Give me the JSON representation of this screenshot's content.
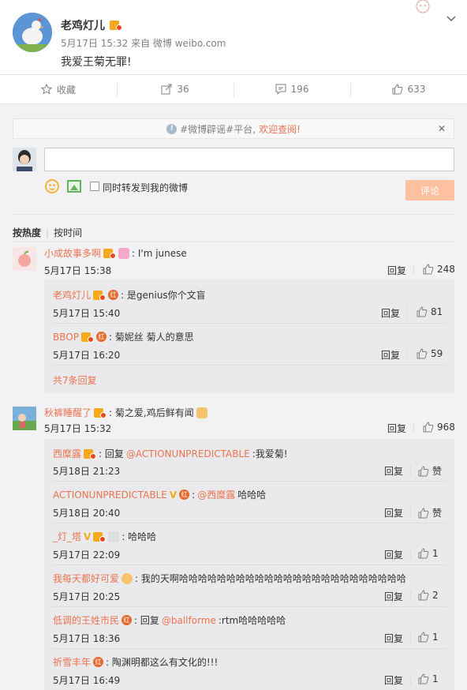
{
  "post": {
    "username": "老鸡灯儿",
    "meta": "5月17日 15:32 来自 微博 weibo.com",
    "text": "我爱王菊无罪!"
  },
  "actions": {
    "favorite": "收藏",
    "repost": "36",
    "comment": "196",
    "like": "633"
  },
  "notice": {
    "prefix": "#微博辟谣#平台,",
    "link": "欢迎查阅!"
  },
  "composer": {
    "forward_label": "同时转发到我的微博",
    "submit": "评论"
  },
  "sort": {
    "hot": "按热度",
    "time": "按时间"
  },
  "comments": [
    {
      "nick": "小成故事多啊",
      "text": ": I'm junese",
      "time": "5月17日 15:38",
      "reply": "回复",
      "likes": "248",
      "replies": [
        {
          "nick": "老鸡灯儿",
          "text": ": 是genius你个文盲",
          "time": "5月17日 15:40",
          "reply": "回复",
          "likes": "81"
        },
        {
          "nick": "BBOP",
          "text": ": 菊妮丝 菊人的意思",
          "time": "5月17日 16:20",
          "reply": "回复",
          "likes": "59"
        }
      ],
      "more": "共7条回复"
    },
    {
      "nick": "秋裤睡醒了",
      "text": ": 菊之爱,鸡后鲜有闻",
      "time": "5月17日 15:32",
      "reply": "回复",
      "likes": "968",
      "replies": [
        {
          "nick": "西糜露",
          "pre": ": 回复",
          "at": "@ACTIONUNPREDICTABLE",
          "text": ":我爱菊!",
          "time": "5月18日 21:23",
          "reply": "回复",
          "likes": "赞"
        },
        {
          "nick": "ACTIONUNPREDICTABLE",
          "pre": ":",
          "at": "@西糜露",
          "text": " 哈哈哈",
          "time": "5月18日 20:40",
          "reply": "回复",
          "likes": "赞"
        },
        {
          "nick": "_灯_塔",
          "text": ": 哈哈哈",
          "time": "5月17日 22:09",
          "reply": "回复",
          "likes": "1"
        },
        {
          "nick": "我每天都好可爱",
          "text": ": 我的天啊哈哈哈哈哈哈哈哈哈哈哈哈哈哈哈哈哈哈哈哈哈哈哈哈",
          "time": "5月17日 20:25",
          "reply": "回复",
          "likes": "2"
        },
        {
          "nick": "低调的王姓市民",
          "pre": ": 回复",
          "at": "@ballforme",
          "text": ":rtm哈哈哈哈哈",
          "time": "5月17日 18:36",
          "reply": "回复",
          "likes": "1"
        },
        {
          "nick": "祈雪丰年",
          "text": ": 陶渊明都这么有文化的!!!",
          "time": "5月17日 16:49",
          "reply": "回复",
          "likes": "1"
        }
      ]
    }
  ],
  "colors": {
    "accent": "#eb7350",
    "panel_bg": "#f2f2f5",
    "reply_bg": "#eaeaec",
    "submit_bg": "#ffc09f"
  }
}
